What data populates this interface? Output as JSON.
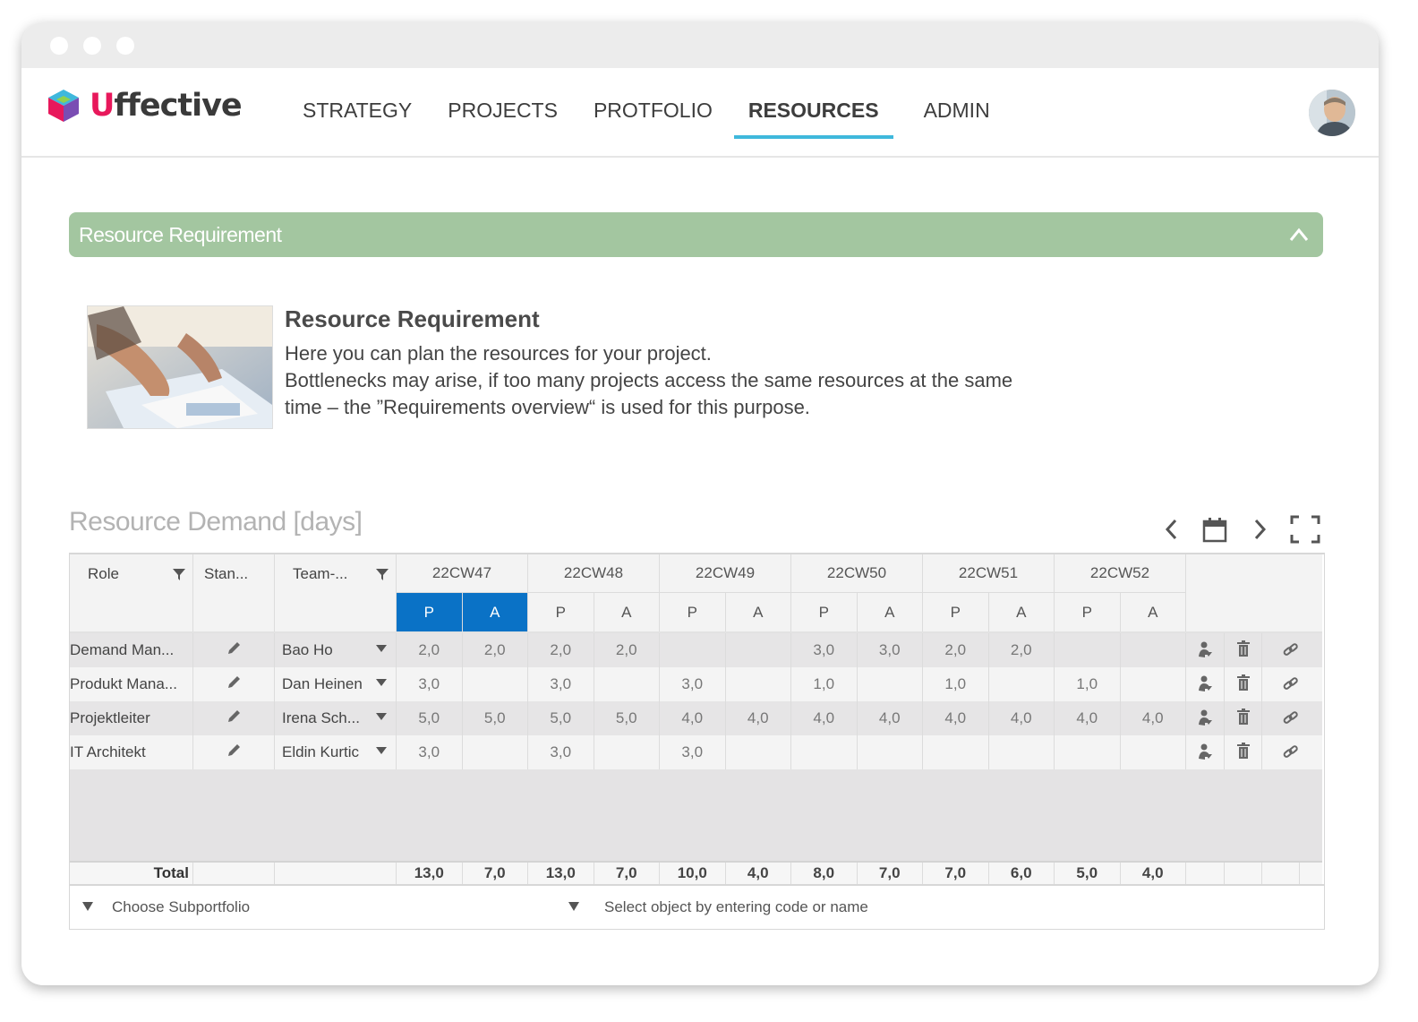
{
  "app": {
    "logo_text": "ffective",
    "logo_letter": "U"
  },
  "nav": {
    "items": [
      "STRATEGY",
      "PROJECTS",
      "PROTFOLIO",
      "RESOURCES",
      "ADMIN"
    ],
    "active": "RESOURCES"
  },
  "section": {
    "title": "Resource Requirement"
  },
  "intro": {
    "title": "Resource Requirement",
    "line1": "Here you can plan the resources for your project.",
    "line2": "Bottlenecks may arise, if too many projects access the same resources at the same",
    "line3": "time – the ”Requirements overview“ is used for this purpose."
  },
  "demand": {
    "title": "Resource Demand [days]",
    "columns": {
      "role": "Role",
      "standard": "Stan...",
      "team": "Team-..."
    },
    "weeks": [
      "22CW47",
      "22CW48",
      "22CW49",
      "22CW50",
      "22CW51",
      "22CW52"
    ],
    "sub_p": "P",
    "sub_a": "A",
    "rows": [
      {
        "role": "Demand Man...",
        "member": "Bao Ho",
        "values": [
          "2,0",
          "2,0",
          "2,0",
          "2,0",
          "",
          "",
          "3,0",
          "3,0",
          "2,0",
          "2,0",
          "",
          ""
        ]
      },
      {
        "role": "Produkt Mana...",
        "member": "Dan Heinen",
        "values": [
          "3,0",
          "",
          "3,0",
          "",
          "3,0",
          "",
          "1,0",
          "",
          "1,0",
          "",
          "1,0",
          ""
        ]
      },
      {
        "role": "Projektleiter",
        "member": "Irena Sch...",
        "values": [
          "5,0",
          "5,0",
          "5,0",
          "5,0",
          "4,0",
          "4,0",
          "4,0",
          "4,0",
          "4,0",
          "4,0",
          "4,0",
          "4,0"
        ]
      },
      {
        "role": "IT Architekt",
        "member": "Eldin Kurtic",
        "values": [
          "3,0",
          "",
          "3,0",
          "",
          "3,0",
          "",
          "",
          "",
          "",
          "",
          "",
          ""
        ]
      }
    ],
    "total_label": "Total",
    "totals": [
      "13,0",
      "7,0",
      "13,0",
      "7,0",
      "10,0",
      "4,0",
      "8,0",
      "7,0",
      "7,0",
      "6,0",
      "5,0",
      "4,0"
    ]
  },
  "footer": {
    "subportfolio_placeholder": "Choose Subportfolio",
    "object_placeholder": "Select object by entering code or name"
  },
  "colors": {
    "accent_blue": "#0a72c6",
    "nav_underline": "#3fb8dc",
    "section_green": "#a3c6a0",
    "logo_pink": "#e8185b"
  }
}
